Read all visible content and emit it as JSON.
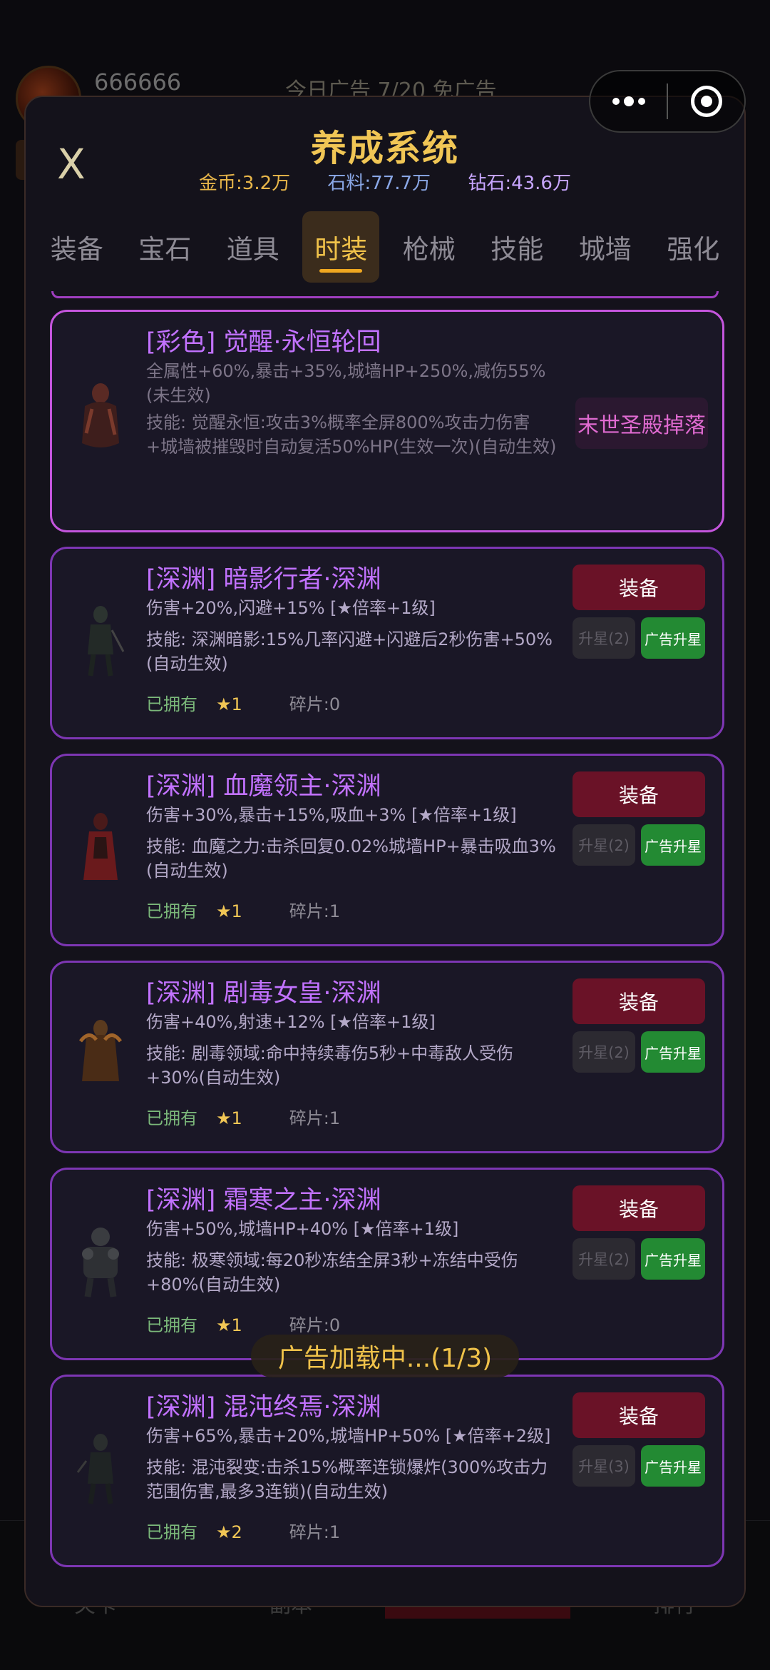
{
  "background": {
    "username": "666666",
    "ad_text": "今日广告 7/20 免广告",
    "bottom_tabs": [
      "关卡",
      "副本",
      "养成",
      "排行"
    ]
  },
  "modal": {
    "close_label": "X",
    "title": "养成系统",
    "currency": {
      "gold": "金币:3.2万",
      "stone": "石料:77.7万",
      "diamond": "钻石:43.6万"
    },
    "tabs": [
      "装备",
      "宝石",
      "道具",
      "时装",
      "枪械",
      "技能",
      "城墙",
      "强化"
    ],
    "active_tab": "时装"
  },
  "items": [
    {
      "name": "[彩色] 觉醒·永恒轮回",
      "stats": "全属性+60%,暴击+35%,城墙HP+250%,减伤55% (未生效)",
      "skill": "技能: 觉醒永恒:攻击3%概率全屏800%攻击力伤害+城墙被摧毁时自动复活50%HP(生效一次)(自动生效)",
      "drop": "末世圣殿掉落"
    },
    {
      "name": "[深渊] 暗影行者·深渊",
      "stats": "伤害+20%,闪避+15% [★倍率+1级]",
      "skill": "技能: 深渊暗影:15%几率闪避+闪避后2秒伤害+50%(自动生效)",
      "owned": "已拥有",
      "stars": "★1",
      "fragments": "碎片:0",
      "equip": "装备",
      "upstar": "升星(2)",
      "ad_upstar": "广告升星"
    },
    {
      "name": "[深渊] 血魔领主·深渊",
      "stats": "伤害+30%,暴击+15%,吸血+3% [★倍率+1级]",
      "skill": "技能: 血魔之力:击杀回复0.02%城墙HP+暴击吸血3%(自动生效)",
      "owned": "已拥有",
      "stars": "★1",
      "fragments": "碎片:1",
      "equip": "装备",
      "upstar": "升星(2)",
      "ad_upstar": "广告升星"
    },
    {
      "name": "[深渊] 剧毒女皇·深渊",
      "stats": "伤害+40%,射速+12% [★倍率+1级]",
      "skill": "技能: 剧毒领域:命中持续毒伤5秒+中毒敌人受伤+30%(自动生效)",
      "owned": "已拥有",
      "stars": "★1",
      "fragments": "碎片:1",
      "equip": "装备",
      "upstar": "升星(2)",
      "ad_upstar": "广告升星"
    },
    {
      "name": "[深渊] 霜寒之主·深渊",
      "stats": "伤害+50%,城墙HP+40% [★倍率+1级]",
      "skill": "技能: 极寒领域:每20秒冻结全屏3秒+冻结中受伤+80%(自动生效)",
      "owned": "已拥有",
      "stars": "★1",
      "fragments": "碎片:0",
      "equip": "装备",
      "upstar": "升星(2)",
      "ad_upstar": "广告升星"
    },
    {
      "name": "[深渊] 混沌终焉·深渊",
      "stats": "伤害+65%,暴击+20%,城墙HP+50% [★倍率+2级]",
      "skill": "技能: 混沌裂变:击杀15%概率连锁爆炸(300%攻击力范围伤害,最多3连锁)(自动生效)",
      "owned": "已拥有",
      "stars": "★2",
      "fragments": "碎片:1",
      "equip": "装备",
      "upstar": "升星(3)",
      "ad_upstar": "广告升星"
    }
  ],
  "toast": "广告加载中...(1/3)",
  "colors": {
    "title_gold": "#f1c655",
    "abyss_purple": "#c272ff",
    "equip_red": "#6a1227",
    "ad_green": "#238a33"
  }
}
